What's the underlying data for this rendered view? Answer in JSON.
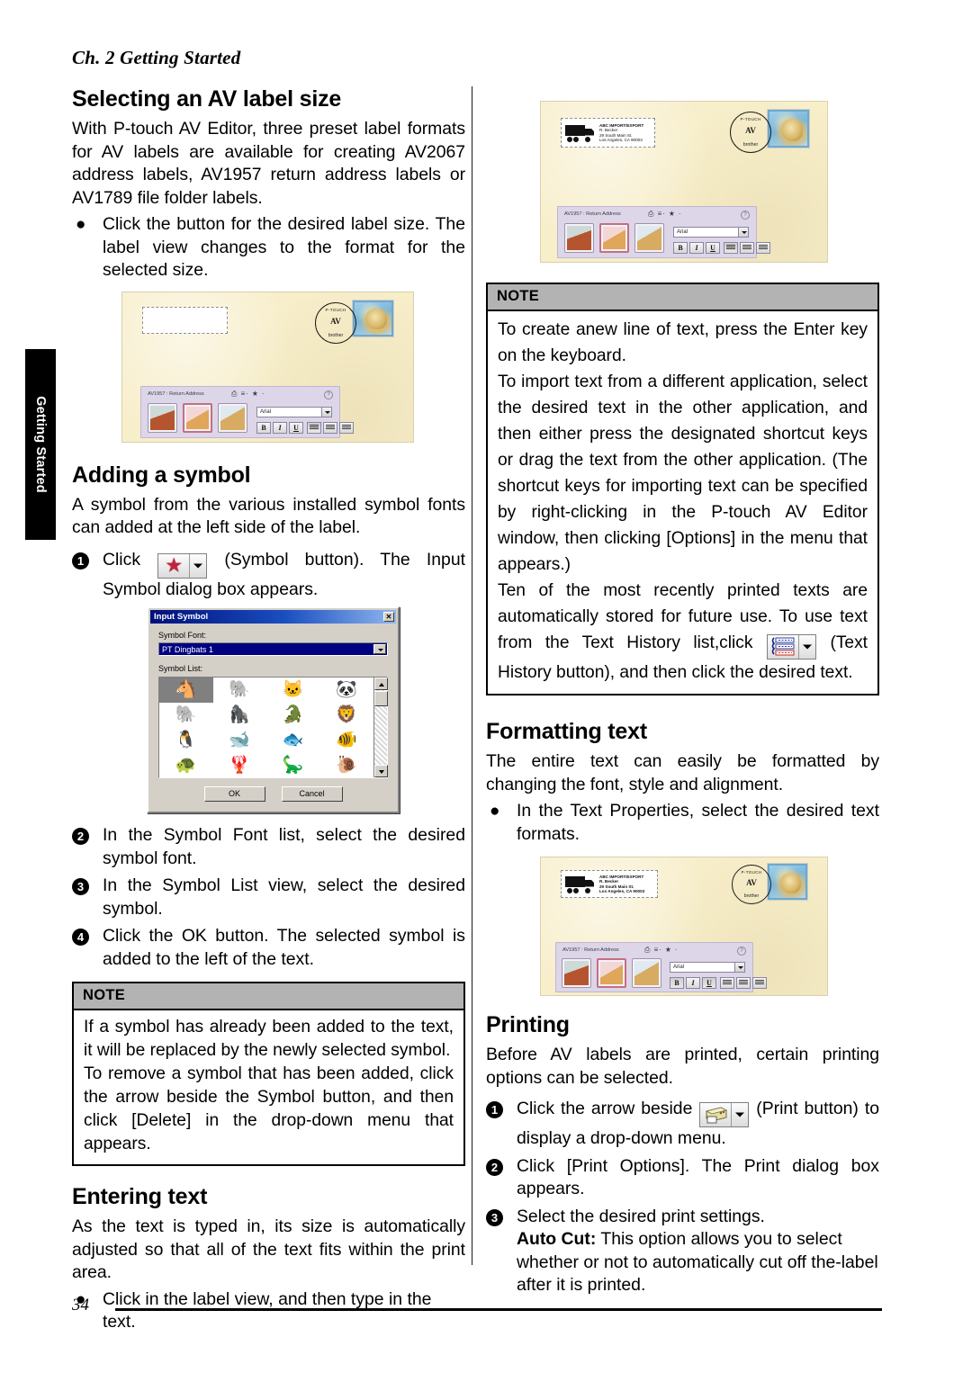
{
  "page": {
    "chapter_header": "Ch. 2 Getting Started",
    "side_tab": "Getting Started",
    "page_number": "34"
  },
  "left_column": {
    "section1": {
      "heading": "Selecting an AV label size",
      "paragraph": "With P-touch AV Editor, three preset label formats for AV labels are available for creating AV2067 address labels, AV1957 return address labels or AV1789 file folder labels.",
      "bullet": "Click the button for the desired label size. The label view changes to the format for the selected size."
    },
    "screenshot1": {
      "toolbar_title": "AV1957 : Return Address",
      "font_value": "Arial",
      "bold_label": "B",
      "italic_label": "I",
      "underline_label": "U",
      "postmark_top": "P-TOUCH",
      "postmark_av": "AV",
      "postmark_brand": "brother",
      "stamp_av": "AV"
    },
    "section2": {
      "heading": "Adding a symbol",
      "paragraph": "A symbol from the various installed symbol fonts can added at the left side of the label.",
      "step1_pre": "Click",
      "step1_post": "(Symbol button). The Input Symbol dialog box appears."
    },
    "dialog": {
      "title": "Input Symbol",
      "close_label": "✕",
      "symbol_font_label": "Symbol Font:",
      "symbol_font_value": "PT Dingbats 1",
      "symbol_list_label": "Symbol List:",
      "symbols": [
        "🐴",
        "🐘",
        "🐱",
        "🐼",
        "🐘",
        "🦍",
        "🐊",
        "🦁",
        "🐧",
        "🐋",
        "🐟",
        "🐠",
        "🐢",
        "🦞",
        "🦕",
        "🐌"
      ],
      "selected_index": 0,
      "ok_label": "OK",
      "cancel_label": "Cancel"
    },
    "steps": [
      {
        "n": "2",
        "text": "In the Symbol Font list, select the desired symbol font."
      },
      {
        "n": "3",
        "text": "In the Symbol List view, select the desired symbol."
      },
      {
        "n": "4",
        "text": "Click the OK button. The selected symbol is added to the left of the text."
      }
    ],
    "note": {
      "title": "NOTE",
      "paragraphs": [
        "If a symbol has already been added to the text, it will be replaced by the newly selected symbol.",
        "To remove a symbol that has been added, click the arrow beside the Symbol button, and then click [Delete] in the drop-down menu that appears."
      ]
    },
    "section3": {
      "heading": "Entering text",
      "paragraph": "As the text is typed in, its size is automatically adjusted so that all of the text fits within the print area.",
      "bullet": "Click in the label view, and then type in the text."
    }
  },
  "right_column": {
    "screenshot1": {
      "toolbar_title": "AV1957 : Return Address",
      "font_value": "Arial",
      "bold_label": "B",
      "italic_label": "I",
      "underline_label": "U",
      "address": [
        "ABC IMPORT/EXPORT",
        "R. Becker",
        "29 South Main St.",
        "Los Angeles, CA 90003"
      ],
      "postmark_top": "P-TOUCH",
      "postmark_av": "AV",
      "postmark_brand": "brother",
      "stamp_av": "AV"
    },
    "note": {
      "title": "NOTE",
      "p1": "To create anew line of text, press the Enter key on the keyboard.",
      "p2": "To import text from a different application, select the desired text in the other application, and then either press the designated shortcut keys or drag the text from the other application. (The shortcut keys for importing text can be specified by right-clicking in the P-touch AV Editor window, then clicking [Options] in the menu that appears.)",
      "p3_pre": "Ten of the most recently printed texts are automatically stored for future use. To use text from the Text History list,click",
      "p3_post": "(Text History button), and then click the desired text."
    },
    "section_formatting": {
      "heading": "Formatting text",
      "paragraph": "The entire text can easily be formatted by changing the font, style and alignment.",
      "bullet": "In the Text Properties, select the desired text formats."
    },
    "screenshot2": {
      "toolbar_title": "AV1957 : Return Address",
      "font_value": "Arial",
      "bold_label": "B",
      "italic_label": "I",
      "underline_label": "U",
      "address": [
        "ABC IMPORT/EXPORT",
        "R. Becker",
        "29 South Main St.",
        "Los Angeles, CA 90003"
      ],
      "postmark_top": "P-TOUCH",
      "postmark_av": "AV",
      "postmark_brand": "brother",
      "stamp_av": "AV"
    },
    "section_printing": {
      "heading": "Printing",
      "paragraph": "Before AV labels are printed, certain printing options can be selected.",
      "step1_pre": "Click the arrow beside",
      "step1_post": "(Print button) to display a drop-down menu.",
      "step2": "Click [Print Options]. The Print dialog box appears.",
      "step3_line1": "Select the desired print settings.",
      "step3_bold": "Auto Cut:",
      "step3_rest": " This option allows you to select whether or not to automatically cut off the-label after it is printed."
    }
  },
  "colors": {
    "label_paper": "#f7eeca",
    "toolbar": "#ddd6e8",
    "note_header": "#b3b3b3",
    "dialog_face": "#d4d0c8",
    "dialog_title": "#000080",
    "star_red": "#c0243c"
  }
}
